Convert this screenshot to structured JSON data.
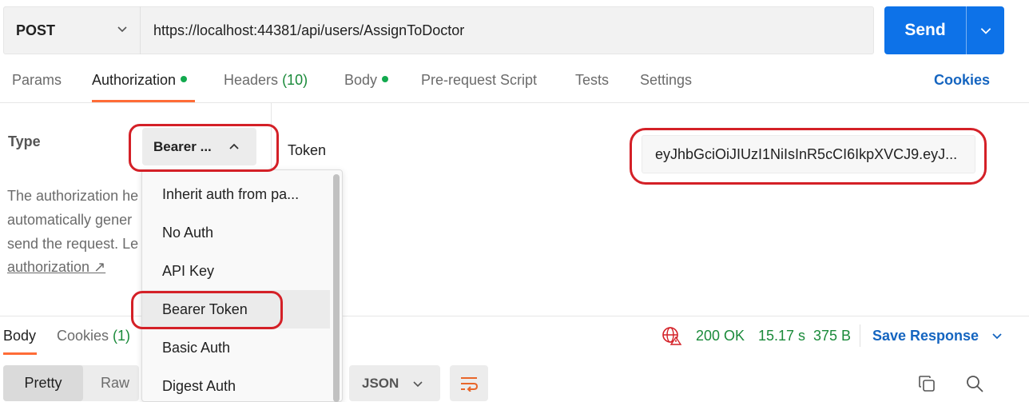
{
  "request": {
    "method": "POST",
    "url": "https://localhost:44381/api/users/AssignToDoctor",
    "send_label": "Send"
  },
  "tabs": [
    {
      "label": "Params",
      "count": ""
    },
    {
      "label": "Authorization",
      "count": ""
    },
    {
      "label": "Headers",
      "count": "(10)"
    },
    {
      "label": "Body",
      "count": ""
    },
    {
      "label": "Pre-request Script",
      "count": ""
    },
    {
      "label": "Tests",
      "count": ""
    },
    {
      "label": "Settings",
      "count": ""
    }
  ],
  "cookies_link": "Cookies",
  "auth": {
    "type_label": "Type",
    "type_selected": "Bearer ...",
    "description_lines": [
      "The authorization he",
      "automatically gener",
      "send the request. Le"
    ],
    "learn_link": "authorization ↗",
    "token_label": "Token",
    "token_value": "eyJhbGciOiJIUzI1NiIsInR5cCI6IkpXVCJ9.eyJ..."
  },
  "type_menu": {
    "items": [
      "Inherit auth from pa...",
      "No Auth",
      "API Key",
      "Bearer Token",
      "Basic Auth",
      "Digest Auth"
    ],
    "selected": "Bearer Token"
  },
  "response": {
    "tabs": [
      {
        "label": "Body",
        "count": ""
      },
      {
        "label": "Cookies",
        "count": "(1)"
      }
    ],
    "status": "200 OK",
    "time": "15.17 s",
    "size": "375 B",
    "save_label": "Save Response",
    "views": [
      "Pretty",
      "Raw"
    ],
    "format": "JSON"
  },
  "colors": {
    "accent": "#ff6c37",
    "send": "#0d72e8",
    "link": "#1565c0",
    "success": "#1a8a3a",
    "annotation": "#d42027"
  }
}
